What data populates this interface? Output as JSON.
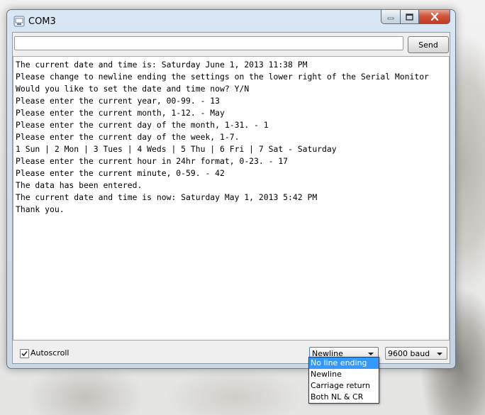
{
  "window": {
    "title": "COM3",
    "icon": "arduino-serial-icon",
    "caption_buttons": [
      "minimize-icon",
      "maximize-icon",
      "close-icon"
    ]
  },
  "send_bar": {
    "input_value": "",
    "send_label": "Send"
  },
  "output": {
    "lines": [
      "The current date and time is: Saturday June 1, 2013 11:38 PM",
      "Please change to newline ending the settings on the lower right of the Serial Monitor",
      "Would you like to set the date and time now? Y/N",
      "Please enter the current year, 00-99. - 13",
      "Please enter the current month, 1-12. - May",
      "Please enter the current day of the month, 1-31. - 1",
      "Please enter the current day of the week, 1-7.",
      "1 Sun | 2 Mon | 3 Tues | 4 Weds | 5 Thu | 6 Fri | 7 Sat - Saturday",
      "Please enter the current hour in 24hr format, 0-23. - 17",
      "Please enter the current minute, 0-59. - 42",
      "The data has been entered.",
      "The current date and time is now: Saturday May 1, 2013 5:42 PM",
      "Thank you."
    ]
  },
  "bottom_bar": {
    "autoscroll_label": "Autoscroll",
    "autoscroll_checked": true,
    "line_ending_selected": "Newline",
    "baud_selected": "9600 baud"
  },
  "line_ending_dropdown": {
    "options": [
      "No line ending",
      "Newline",
      "Carriage return",
      "Both NL & CR"
    ],
    "highlighted_index": 0
  },
  "colors": {
    "highlight": "#3399ff",
    "close_button": "#c23b22",
    "window_frame": "#d7e6f5"
  }
}
